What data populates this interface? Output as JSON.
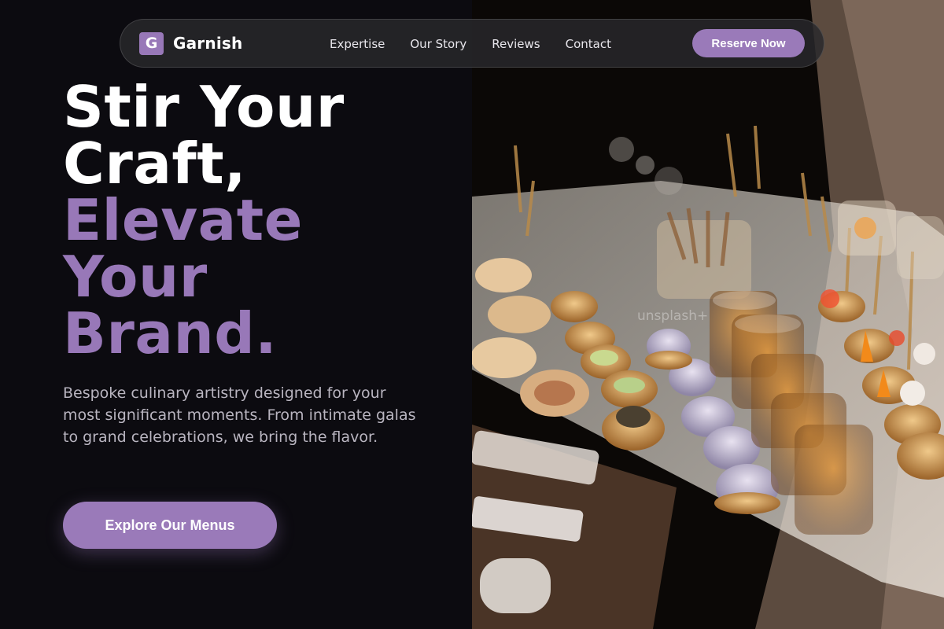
{
  "nav": {
    "logo_letter": "G",
    "brand": "Garnish",
    "links": [
      "Expertise",
      "Our Story",
      "Reviews",
      "Contact"
    ],
    "cta": "Reserve Now"
  },
  "hero": {
    "headline_white": [
      "Stir Your",
      "Craft,"
    ],
    "headline_accent": [
      "Elevate",
      "Your",
      "Brand."
    ],
    "subtext": "Bespoke culinary artistry designed for your most significant moments. From intimate galas to grand celebrations, we bring the flavor.",
    "cta": "Explore Our Menus"
  },
  "image": {
    "description_icon": "catering-platter-photo",
    "watermark": "unsplash+"
  },
  "colors": {
    "accent": "#9878b8",
    "background": "#0c0b10",
    "nav_bg": "#28282c"
  }
}
